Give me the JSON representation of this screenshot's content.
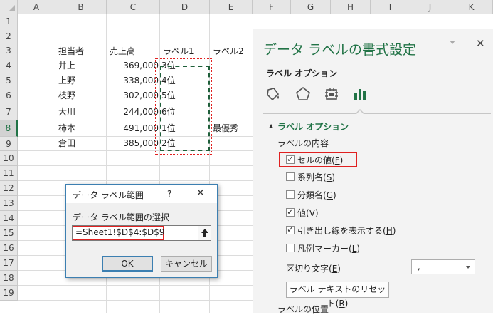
{
  "columns": [
    "A",
    "B",
    "C",
    "D",
    "E",
    "F",
    "G",
    "H",
    "I",
    "J",
    "K"
  ],
  "rows": [
    "1",
    "2",
    "3",
    "4",
    "5",
    "6",
    "7",
    "8",
    "9",
    "10",
    "11",
    "12",
    "13",
    "14",
    "15",
    "16",
    "17",
    "18",
    "19"
  ],
  "headers": {
    "tanto": "担当者",
    "uriage": "売上高",
    "label1": "ラベル1",
    "label2": "ラベル2"
  },
  "table": [
    {
      "name": "井上",
      "sales": "369,000",
      "rank": "3位",
      "label2": ""
    },
    {
      "name": "上野",
      "sales": "338,000",
      "rank": "4位",
      "label2": ""
    },
    {
      "name": "枝野",
      "sales": "302,000",
      "rank": "5位",
      "label2": ""
    },
    {
      "name": "大川",
      "sales": "244,000",
      "rank": "6位",
      "label2": ""
    },
    {
      "name": "柿本",
      "sales": "491,000",
      "rank": "1位",
      "label2": "最優秀"
    },
    {
      "name": "倉田",
      "sales": "385,000",
      "rank": "2位",
      "label2": ""
    }
  ],
  "pane": {
    "title": "データ ラベルの書式設定",
    "tab": "ラベル オプション",
    "section": "ラベル オプション",
    "contents_heading": "ラベルの内容",
    "options": [
      {
        "label": "セルの値(",
        "key": "F",
        "checked": true
      },
      {
        "label": "系列名(",
        "key": "S",
        "checked": false
      },
      {
        "label": "分類名(",
        "key": "G",
        "checked": false
      },
      {
        "label": "値(",
        "key": "V",
        "checked": true
      },
      {
        "label": "引き出し線を表示する(",
        "key": "H",
        "checked": true
      },
      {
        "label": "凡例マーカー(",
        "key": "L",
        "checked": false
      }
    ],
    "separator_label": "区切り文字(",
    "separator_key": "E",
    "separator_value": ",",
    "reset_label": "ラベル テキストのリセット(",
    "reset_key": "R",
    "position_heading": "ラベルの位置"
  },
  "dialog": {
    "title": "データ ラベル範囲",
    "help": "?",
    "prompt": "データ ラベル範囲の選択",
    "range_value": "=Sheet1!$D$4:$D$9",
    "ok": "OK",
    "cancel": "キャンセル"
  },
  "colors": {
    "accent": "#217346",
    "selection_red": "#e02020",
    "dialog_border": "#3c7fb1"
  }
}
